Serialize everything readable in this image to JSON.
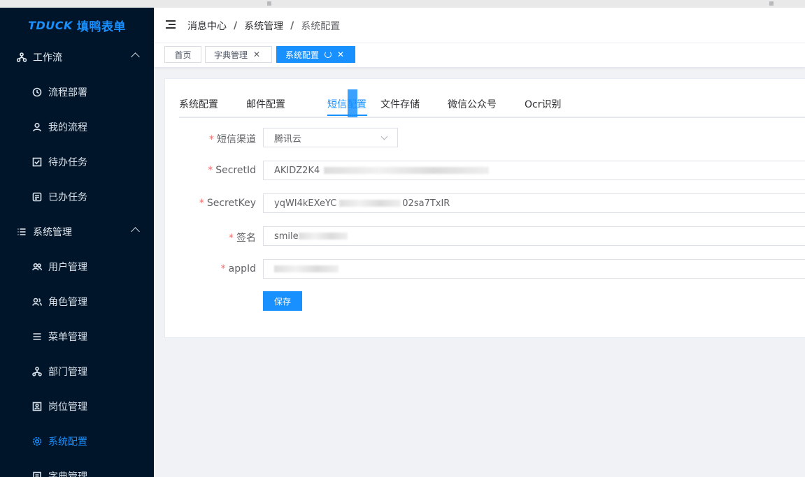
{
  "app": {
    "brand": "TDUCK",
    "name": "填鸭表单"
  },
  "sidebar": {
    "items": [
      {
        "label": "工作流",
        "icon": "workflow-icon",
        "type": "parent"
      },
      {
        "label": "流程部署",
        "icon": "deploy-icon",
        "type": "child"
      },
      {
        "label": "我的流程",
        "icon": "user-icon",
        "type": "child"
      },
      {
        "label": "待办任务",
        "icon": "checkbox-icon",
        "type": "child"
      },
      {
        "label": "已办任务",
        "icon": "form-icon",
        "type": "child"
      },
      {
        "label": "系统管理",
        "icon": "list-icon",
        "type": "parent"
      },
      {
        "label": "用户管理",
        "icon": "peoples-icon",
        "type": "child"
      },
      {
        "label": "角色管理",
        "icon": "people-icon",
        "type": "child"
      },
      {
        "label": "菜单管理",
        "icon": "menu-icon",
        "type": "child"
      },
      {
        "label": "部门管理",
        "icon": "tree-icon",
        "type": "child"
      },
      {
        "label": "岗位管理",
        "icon": "post-icon",
        "type": "child"
      },
      {
        "label": "系统配置",
        "icon": "settings-icon",
        "type": "child",
        "active": true
      },
      {
        "label": "字典管理",
        "icon": "dict-icon",
        "type": "child"
      }
    ]
  },
  "header": {
    "breadcrumb": [
      "消息中心",
      "系统管理",
      "系统配置"
    ]
  },
  "tags": [
    {
      "label": "首页",
      "closable": false
    },
    {
      "label": "字典管理",
      "closable": true
    },
    {
      "label": "系统配置",
      "closable": true,
      "active": true
    }
  ],
  "config_tabs": [
    {
      "label": "系统配置"
    },
    {
      "label": "邮件配置"
    },
    {
      "label": "短信配置",
      "active": true
    },
    {
      "label": "文件存储"
    },
    {
      "label": "微信公众号"
    },
    {
      "label": "Ocr识别"
    }
  ],
  "form": {
    "channel": {
      "label": "短信渠道",
      "value": "腾讯云",
      "required": true
    },
    "secret_id": {
      "label": "SecretId",
      "value_visible": "AKIDZ2K4",
      "required": true
    },
    "secret_key": {
      "label": "SecretKey",
      "value_prefix": "yqWI4kEXeYC",
      "value_suffix": "02sa7TxIR",
      "required": true
    },
    "sign_name": {
      "label": "签名",
      "value_visible": "smile",
      "required": true
    },
    "app_id": {
      "label": "appId",
      "required": true
    },
    "save_label": "保存"
  },
  "colors": {
    "primary": "#1890ff",
    "sidebar_bg": "#001529",
    "required": "#f56c6c"
  }
}
